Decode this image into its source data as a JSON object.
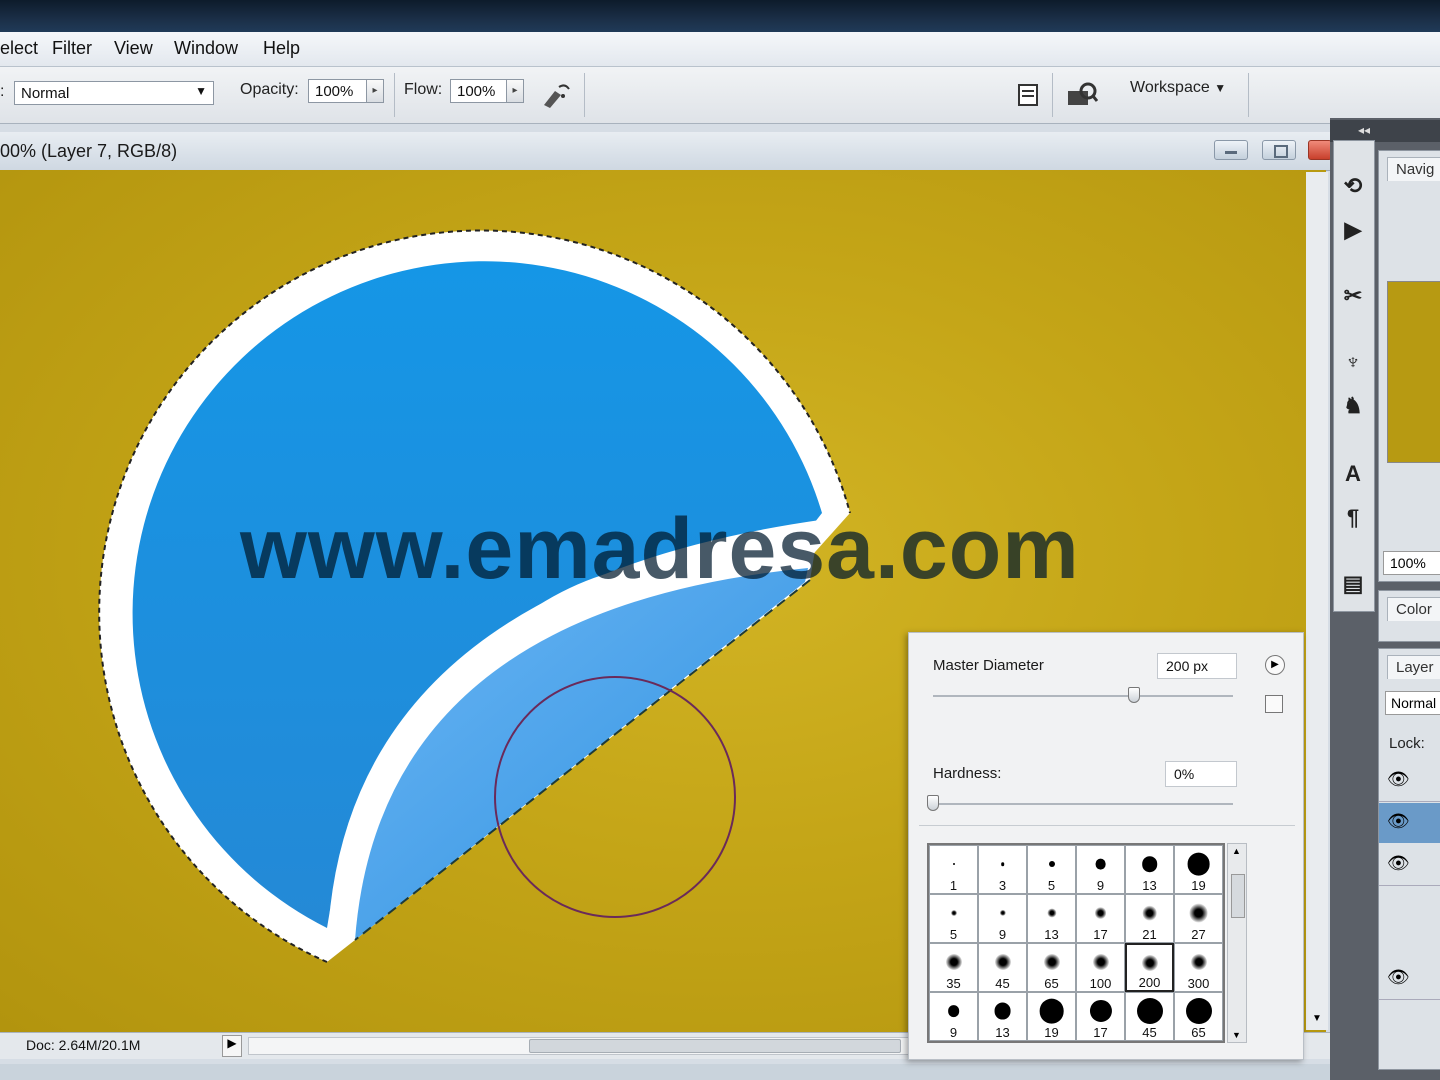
{
  "menu": [
    "elect",
    "Filter",
    "View",
    "Window",
    "Help"
  ],
  "options": {
    "mode_prefix": ":",
    "mode_value": "Normal",
    "opacity_label": "Opacity:",
    "opacity_value": "100%",
    "flow_label": "Flow:",
    "flow_value": "100%",
    "workspace_label": "Workspace"
  },
  "document": {
    "title": "00% (Layer 7, RGB/8)",
    "watermark": "www.emadresa.com",
    "status": "Doc: 2.64M/20.1M"
  },
  "brush_panel": {
    "master_diameter_label": "Master Diameter",
    "master_diameter_value": "200 px",
    "master_diameter_pos": 0.67,
    "hardness_label": "Hardness:",
    "hardness_value": "0%",
    "hardness_pos": 0.0,
    "presets": [
      [
        "1",
        "3",
        "5",
        "9",
        "13",
        "19"
      ],
      [
        "5",
        "9",
        "13",
        "17",
        "21",
        "27"
      ],
      [
        "35",
        "45",
        "65",
        "100",
        "200",
        "300"
      ],
      [
        "9",
        "13",
        "19",
        "17",
        "45",
        "65"
      ]
    ],
    "selected": "200"
  },
  "panels": {
    "navigator_tab": "Navig",
    "zoom_value": "100%",
    "color_tab": "Color",
    "layers_tab": "Layer",
    "blend_value": "Normal",
    "lock_label": "Lock:"
  },
  "colors": {
    "canvas": "#c4a517",
    "sticker_blue": "#1a8fe0",
    "peel_blue": "#55a8ee",
    "watermark": "#002438"
  }
}
